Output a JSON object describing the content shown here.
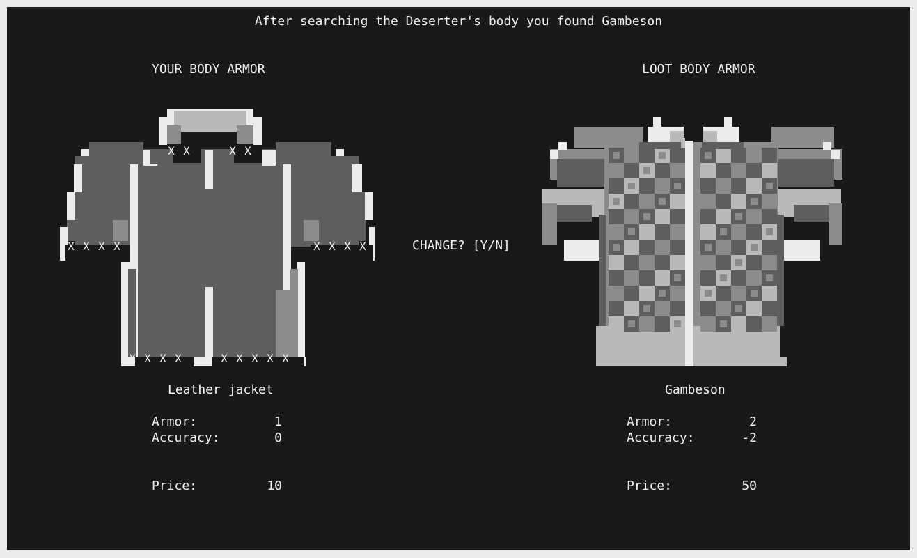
{
  "message": "After searching the Deserter's body you found Gambeson",
  "prompt": "CHANGE? [Y/N]",
  "player_armor": {
    "section_title": "YOUR BODY ARMOR",
    "name": "Leather jacket",
    "armor_label": "Armor:",
    "armor_value": "1",
    "accuracy_label": "Accuracy:",
    "accuracy_value": "0",
    "price_label": "Price:",
    "price_value": "10",
    "hole_mark": "X"
  },
  "loot_armor": {
    "section_title": "LOOT BODY ARMOR",
    "name": "Gambeson",
    "armor_label": "Armor:",
    "armor_value": "2",
    "accuracy_label": "Accuracy:",
    "accuracy_value": "-2",
    "price_label": "Price:",
    "price_value": "50"
  },
  "colors": {
    "background": "#191919",
    "text": "#f0f0f0",
    "dark_gray": "#5e5e5e",
    "mid_gray": "#8c8c8c",
    "light_gray": "#b9b9b9",
    "white": "#ececec"
  }
}
